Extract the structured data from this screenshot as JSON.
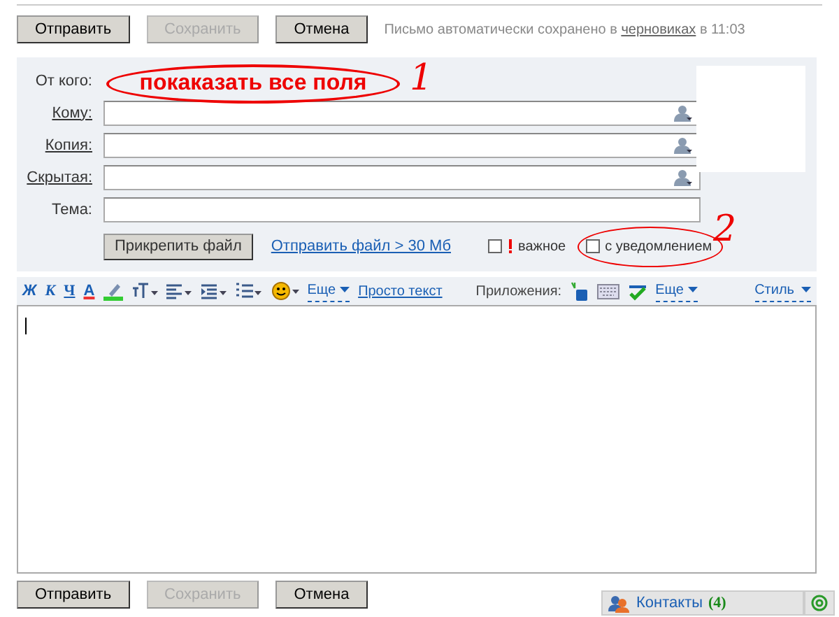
{
  "top_buttons": [
    {
      "label": "Отправить",
      "disabled": false
    },
    {
      "label": "Сохранить",
      "disabled": true
    },
    {
      "label": "Отмена",
      "disabled": false
    }
  ],
  "autosave": {
    "before": "Письмо автоматически сохранено в",
    "link": "черновиках",
    "after": "в 11:03"
  },
  "form": {
    "from_label": "От кого:",
    "fields": [
      {
        "label": "Кому:",
        "kind": "address"
      },
      {
        "label": "Копия:",
        "kind": "address"
      },
      {
        "label": "Скрытая:",
        "kind": "address"
      },
      {
        "label": "Тема:",
        "kind": "subject"
      }
    ],
    "attach_button": "Прикрепить файл",
    "big_file_link": "Отправить файл > 30 Мб",
    "options": [
      {
        "label": "важное",
        "kind": "important",
        "checked": false
      },
      {
        "label": "с уведомлением",
        "kind": "notify",
        "checked": false
      }
    ]
  },
  "editor_toolbar": {
    "format_buttons": [
      "Ж",
      "К",
      "Ч",
      "А"
    ],
    "more": "Еще",
    "plain_text": "Просто текст",
    "apps_label": "Приложения:",
    "apps_more": "Еще",
    "style": "Стиль"
  },
  "bottom_buttons": [
    {
      "label": "Отправить",
      "disabled": false
    },
    {
      "label": "Сохранить",
      "disabled": true
    },
    {
      "label": "Отмена",
      "disabled": false
    }
  ],
  "contacts": {
    "label": "Контакты",
    "count": "(4)"
  },
  "annotations": [
    {
      "kind": "callout",
      "text": "покаказать все поля"
    },
    {
      "kind": "number",
      "text": "1"
    },
    {
      "kind": "number",
      "text": "2"
    }
  ]
}
